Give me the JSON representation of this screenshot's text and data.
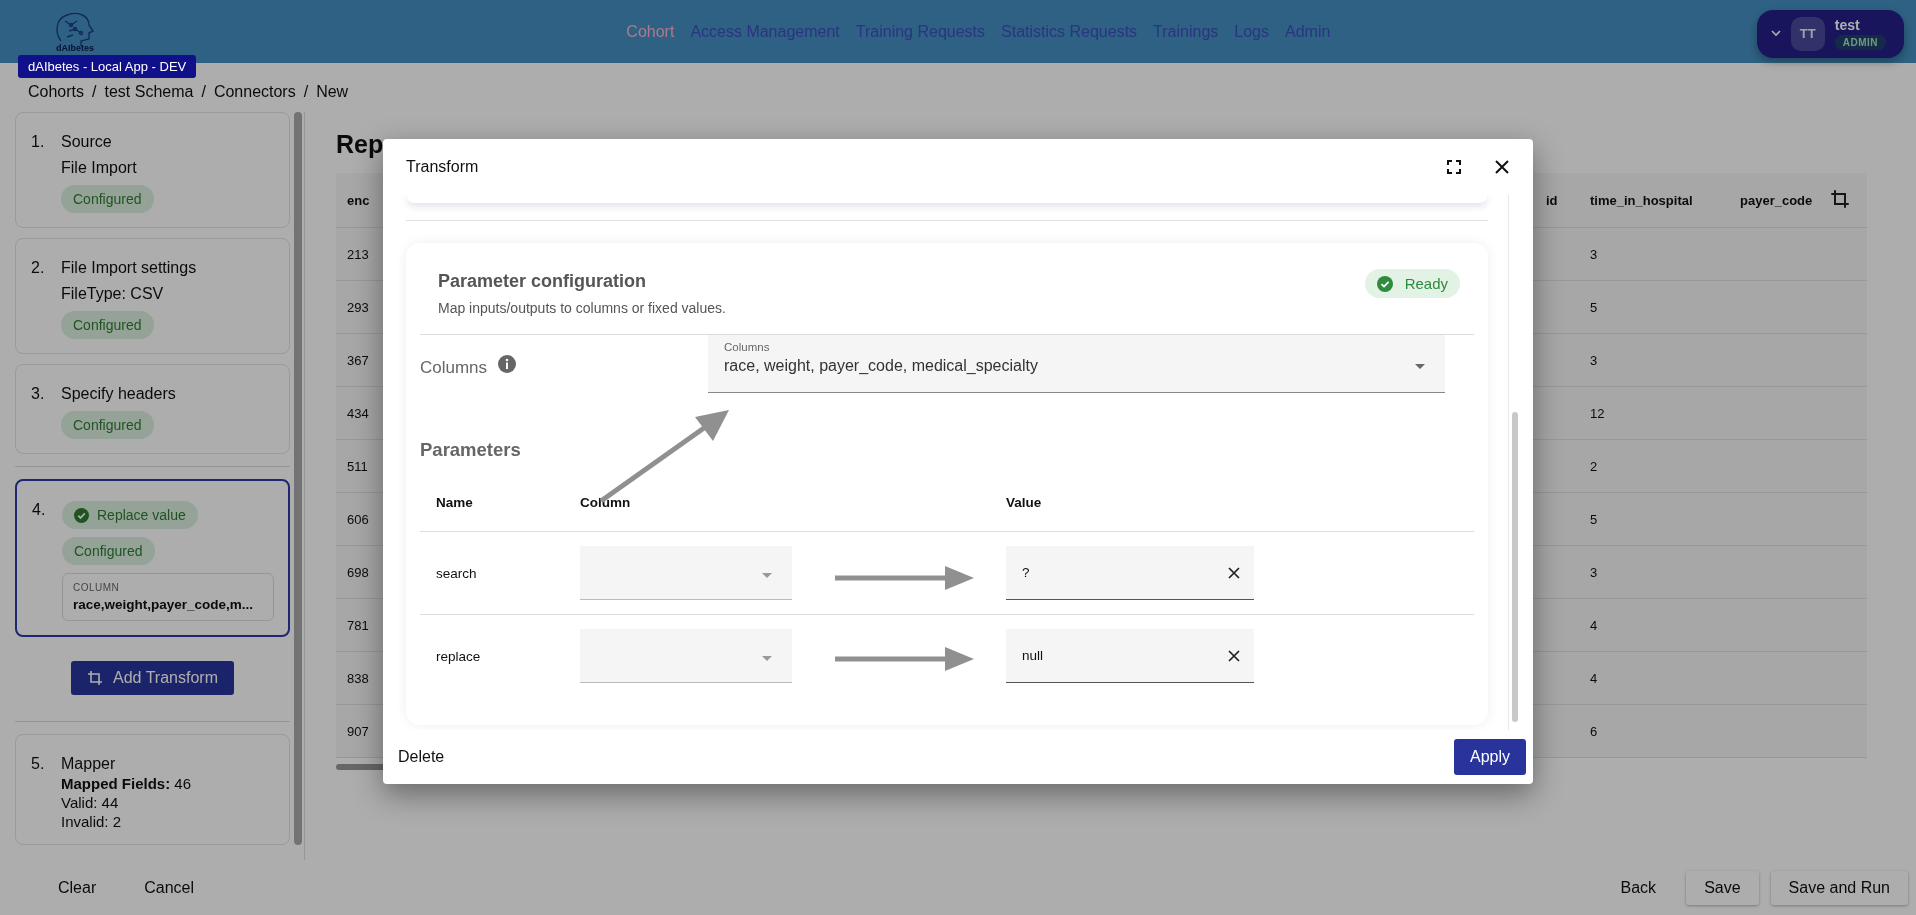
{
  "app": {
    "logo_caption": "dAIbetes",
    "environment_badge": "dAIbetes - Local App - DEV"
  },
  "nav": [
    {
      "label": "Cohort",
      "selected": true
    },
    {
      "label": "Access Management",
      "selected": false
    },
    {
      "label": "Training Requests",
      "selected": false
    },
    {
      "label": "Statistics Requests",
      "selected": false
    },
    {
      "label": "Trainings",
      "selected": false
    },
    {
      "label": "Logs",
      "selected": false
    },
    {
      "label": "Admin",
      "selected": false
    }
  ],
  "user": {
    "initials": "TT",
    "name": "test",
    "role": "ADMIN"
  },
  "breadcrumb": {
    "separator": "/",
    "items": [
      "Cohorts",
      "test Schema",
      "Connectors",
      "New"
    ]
  },
  "steps": [
    {
      "number": "1.",
      "title": "Source",
      "detail": "File Import",
      "status": "Configured",
      "selected": false
    },
    {
      "number": "2.",
      "title": "File Import settings",
      "detail": "FileType: CSV",
      "status": "Configured",
      "selected": false
    },
    {
      "number": "3.",
      "title": "Specify headers",
      "status": "Configured",
      "selected": false
    }
  ],
  "transforms": [
    {
      "number": "4.",
      "name": "Replace value",
      "status": "Configured",
      "field_label": "COLUMN",
      "field_value": "race,weight,payer_code,m...",
      "selected": true
    }
  ],
  "add_transform_button": "Add Transform",
  "mapper": {
    "number": "5.",
    "title": "Mapper",
    "lines": [
      "**Mapped Fields:** 46",
      "Valid: 44",
      "Invalid: 2"
    ]
  },
  "footer": {
    "left": [
      "Clear",
      "Cancel"
    ],
    "right": [
      {
        "label": "Back",
        "kind": "text"
      },
      {
        "label": "Save",
        "kind": "outlined"
      },
      {
        "label": "Save and Run",
        "kind": "outlined"
      }
    ]
  },
  "preview": {
    "title": "Rep",
    "columns": [
      "enc",
      "id",
      "time_in_hospital",
      "payer_code"
    ],
    "rows": [
      {
        "first": "213",
        "time_in_hospital": "3"
      },
      {
        "first": "293",
        "time_in_hospital": "5"
      },
      {
        "first": "367",
        "time_in_hospital": "3"
      },
      {
        "first": "434",
        "time_in_hospital": "12"
      },
      {
        "first": "511",
        "time_in_hospital": "2"
      },
      {
        "first": "606",
        "time_in_hospital": "5"
      },
      {
        "first": "698",
        "time_in_hospital": "3"
      },
      {
        "first": "781",
        "time_in_hospital": "4"
      },
      {
        "first": "838",
        "time_in_hospital": "4"
      },
      {
        "first": "907",
        "time_in_hospital": "6"
      }
    ]
  },
  "dialog": {
    "title": "Transform",
    "section": {
      "title": "Parameter configuration",
      "subtitle": "Map inputs/outputs to columns or fixed values.",
      "status": "Ready"
    },
    "columns_field": {
      "label": "Columns",
      "field_label": "Columns",
      "value": "race, weight, payer_code, medical_specialty"
    },
    "parameters": {
      "title": "Parameters",
      "headers": [
        "Name",
        "Column",
        "Value"
      ],
      "rows": [
        {
          "name": "search",
          "value": "?"
        },
        {
          "name": "replace",
          "value": "null"
        }
      ]
    },
    "delete_button": "Delete",
    "apply_button": "Apply"
  }
}
